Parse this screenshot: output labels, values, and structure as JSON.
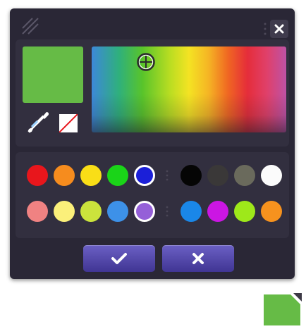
{
  "picker": {
    "current_color": "#66bb46",
    "spectrum_cursor_color": "#2c2a2e"
  },
  "swatches": {
    "row1_left": [
      {
        "color": "#e8161c"
      },
      {
        "color": "#f68c1e"
      },
      {
        "color": "#f9de17"
      },
      {
        "color": "#1ad418"
      },
      {
        "color": "#1b1fd8",
        "selected": true
      }
    ],
    "row1_right": [
      {
        "color": "#050505"
      },
      {
        "color": "#3a3838"
      },
      {
        "color": "#6a6a5c"
      },
      {
        "color": "#fbfbfb"
      }
    ],
    "row2_left": [
      {
        "color": "#f08282"
      },
      {
        "color": "#fbf07a"
      },
      {
        "color": "#cbe33c"
      },
      {
        "color": "#3d91e8"
      },
      {
        "color": "#9560d8",
        "selected": true
      }
    ],
    "row2_right": [
      {
        "color": "#1a87e8"
      },
      {
        "color": "#cb16e3"
      },
      {
        "color": "#9ee81a"
      },
      {
        "color": "#f6921e"
      }
    ]
  },
  "buttons": {
    "ok_icon": "checkmark-icon",
    "cancel_icon": "cross-icon"
  },
  "icons": {
    "grip": "resize-grip-icon",
    "close": "close-icon",
    "eyedropper": "eyedropper-icon",
    "no_color": "no-color-icon"
  },
  "corner_swatch": {
    "color": "#66bb46"
  }
}
